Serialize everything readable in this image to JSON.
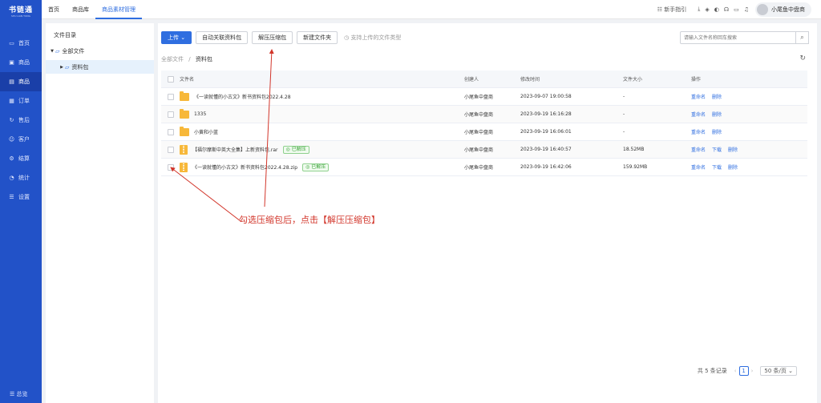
{
  "app": {
    "logo_title": "书链通",
    "logo_sub": "SHU LIAN TONG"
  },
  "sidebar": {
    "items": [
      {
        "label": "首页",
        "icon": "monitor-icon"
      },
      {
        "label": "商品",
        "icon": "goods-icon"
      },
      {
        "label": "商品",
        "icon": "box-icon",
        "active": true
      },
      {
        "label": "订单",
        "icon": "order-icon"
      },
      {
        "label": "售后",
        "icon": "aftersale-icon"
      },
      {
        "label": "客户",
        "icon": "customer-icon"
      },
      {
        "label": "结算",
        "icon": "settle-icon"
      },
      {
        "label": "统计",
        "icon": "stats-icon"
      },
      {
        "label": "设置",
        "icon": "settings-icon"
      }
    ],
    "collapse_label": "总览"
  },
  "topbar": {
    "tabs": [
      {
        "label": "首页"
      },
      {
        "label": "商品库"
      },
      {
        "label": "商品素材管理",
        "active": true
      }
    ],
    "guide_label": "新手指引",
    "user_name": "小尾鱼中盘商"
  },
  "tree": {
    "title": "文件目录",
    "root": "全部文件",
    "child": "资料包"
  },
  "toolbar": {
    "upload": "上传",
    "auto_link": "自动关联资料包",
    "unzip": "解压压缩包",
    "new_folder": "新建文件夹",
    "supported_types": "支持上传的文件类型"
  },
  "search": {
    "placeholder": "请输入文件名称回车搜索"
  },
  "breadcrumb": {
    "root": "全部文件",
    "sep": "/",
    "current": "资料包"
  },
  "table": {
    "headers": {
      "name": "文件名",
      "creator": "创建人",
      "modified": "修改时间",
      "size": "文件大小",
      "ops": "操作"
    },
    "rows": [
      {
        "name": "《一读就懂的小古文》新书资料包2022.4.28",
        "type": "folder",
        "creator": "小尾鱼中盘商",
        "modified": "2023-09-07 19:00:58",
        "size": "-",
        "ops": [
          "重命名",
          "删除"
        ]
      },
      {
        "name": "1335",
        "type": "folder",
        "creator": "小尾鱼中盘商",
        "modified": "2023-09-19 16:16:28",
        "size": "-",
        "ops": [
          "重命名",
          "删除"
        ]
      },
      {
        "name": "小黄和小蓝",
        "type": "folder",
        "creator": "小尾鱼中盘商",
        "modified": "2023-09-19 16:06:01",
        "size": "-",
        "ops": [
          "重命名",
          "删除"
        ]
      },
      {
        "name": "【福尔摩斯中英大全集】上新资料包.rar",
        "type": "archive",
        "badge": "已解压",
        "creator": "小尾鱼中盘商",
        "modified": "2023-09-19 16:40:57",
        "size": "18.52MB",
        "ops": [
          "重命名",
          "下载",
          "删除"
        ]
      },
      {
        "name": "《一读就懂的小古文》新书资料包2022.4.28.zip",
        "type": "archive",
        "badge": "已解压",
        "creator": "小尾鱼中盘商",
        "modified": "2023-09-19 16:42:06",
        "size": "159.92MB",
        "ops": [
          "重命名",
          "下载",
          "删除"
        ]
      }
    ]
  },
  "pagination": {
    "total": "共 5 条记录",
    "current": "1",
    "page_size": "50 条/页"
  },
  "annotation": {
    "text": "勾选压缩包后，点击【解压压缩包】",
    "color": "#d2362b"
  }
}
